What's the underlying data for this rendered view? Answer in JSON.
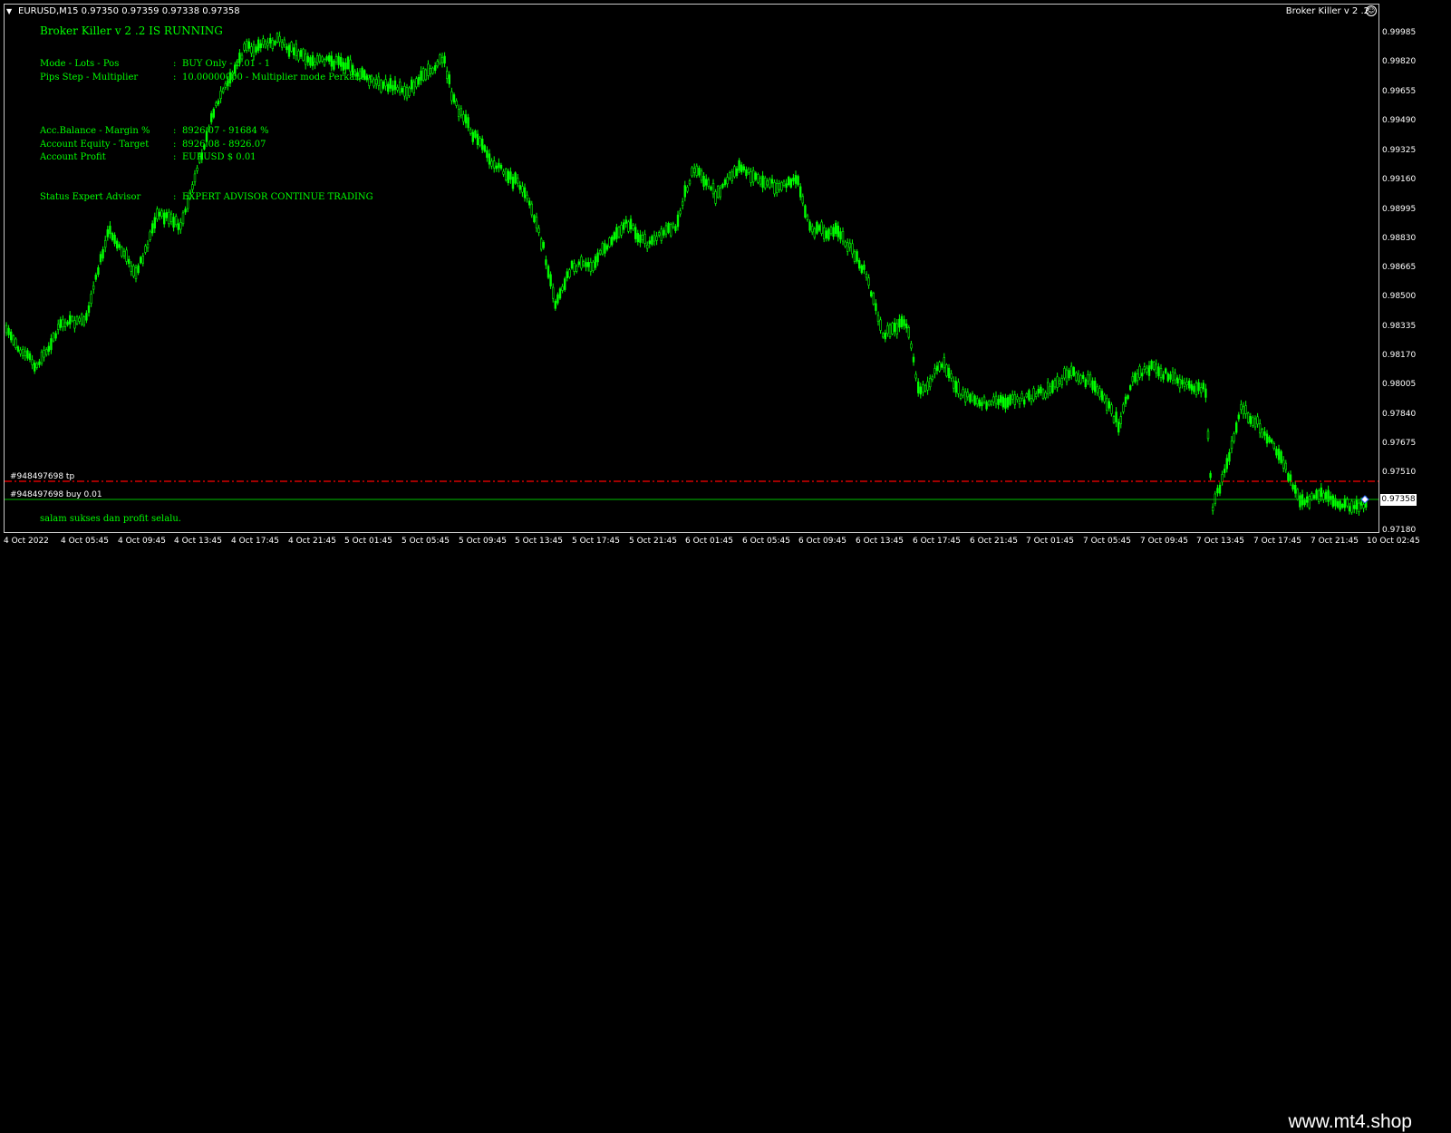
{
  "header": {
    "symbol_info": "EURUSD,M15  0.97350 0.97359 0.97338 0.97358",
    "ea_title_top": "Broker Killer v 2 .2"
  },
  "ea_panel": {
    "running": "Broker Killer v 2 .2 IS RUNNING",
    "separator": ":",
    "rows": [
      {
        "label": "Mode - Lots - Pos",
        "value": "BUY Only - 0.01 - 1"
      },
      {
        "label": "Pips Step - Multiplier",
        "value": "10.00000000 - Multiplier mode Perkalian"
      },
      {
        "label": "Acc.Balance - Margin %",
        "value": "8926.07 - 91684 %"
      },
      {
        "label": "Account Equity - Target",
        "value": "8926.08 - 8926.07"
      },
      {
        "label": "Account Profit",
        "value": "EURUSD $ 0.01"
      },
      {
        "label": "Status Expert Advisor",
        "value": "EXPERT ADVISOR CONTINUE TRADING"
      }
    ],
    "footer": "salam sukses dan profit selalu."
  },
  "orders": {
    "tp_label": "#948497698 tp",
    "buy_label": "#948497698 buy 0.01",
    "current_price": "0.97358"
  },
  "price_axis": [
    "0.99985",
    "0.99820",
    "0.99655",
    "0.99490",
    "0.99325",
    "0.99160",
    "0.98995",
    "0.98830",
    "0.98665",
    "0.98500",
    "0.98335",
    "0.98170",
    "0.98005",
    "0.97840",
    "0.97675",
    "0.97510",
    "0.97180"
  ],
  "time_axis": [
    "4 Oct 2022",
    "4 Oct 05:45",
    "4 Oct 09:45",
    "4 Oct 13:45",
    "4 Oct 17:45",
    "4 Oct 21:45",
    "5 Oct 01:45",
    "5 Oct 05:45",
    "5 Oct 09:45",
    "5 Oct 13:45",
    "5 Oct 17:45",
    "5 Oct 21:45",
    "6 Oct 01:45",
    "6 Oct 05:45",
    "6 Oct 09:45",
    "6 Oct 13:45",
    "6 Oct 17:45",
    "6 Oct 21:45",
    "7 Oct 01:45",
    "7 Oct 05:45",
    "7 Oct 09:45",
    "7 Oct 13:45",
    "7 Oct 17:45",
    "7 Oct 21:45",
    "10 Oct 02:45"
  ],
  "colors": {
    "candle": "#00ff00",
    "tp_line": "#ff0000",
    "order_line": "#00c000",
    "text": "#ffffff"
  },
  "watermark": "www.mt4.shop"
}
